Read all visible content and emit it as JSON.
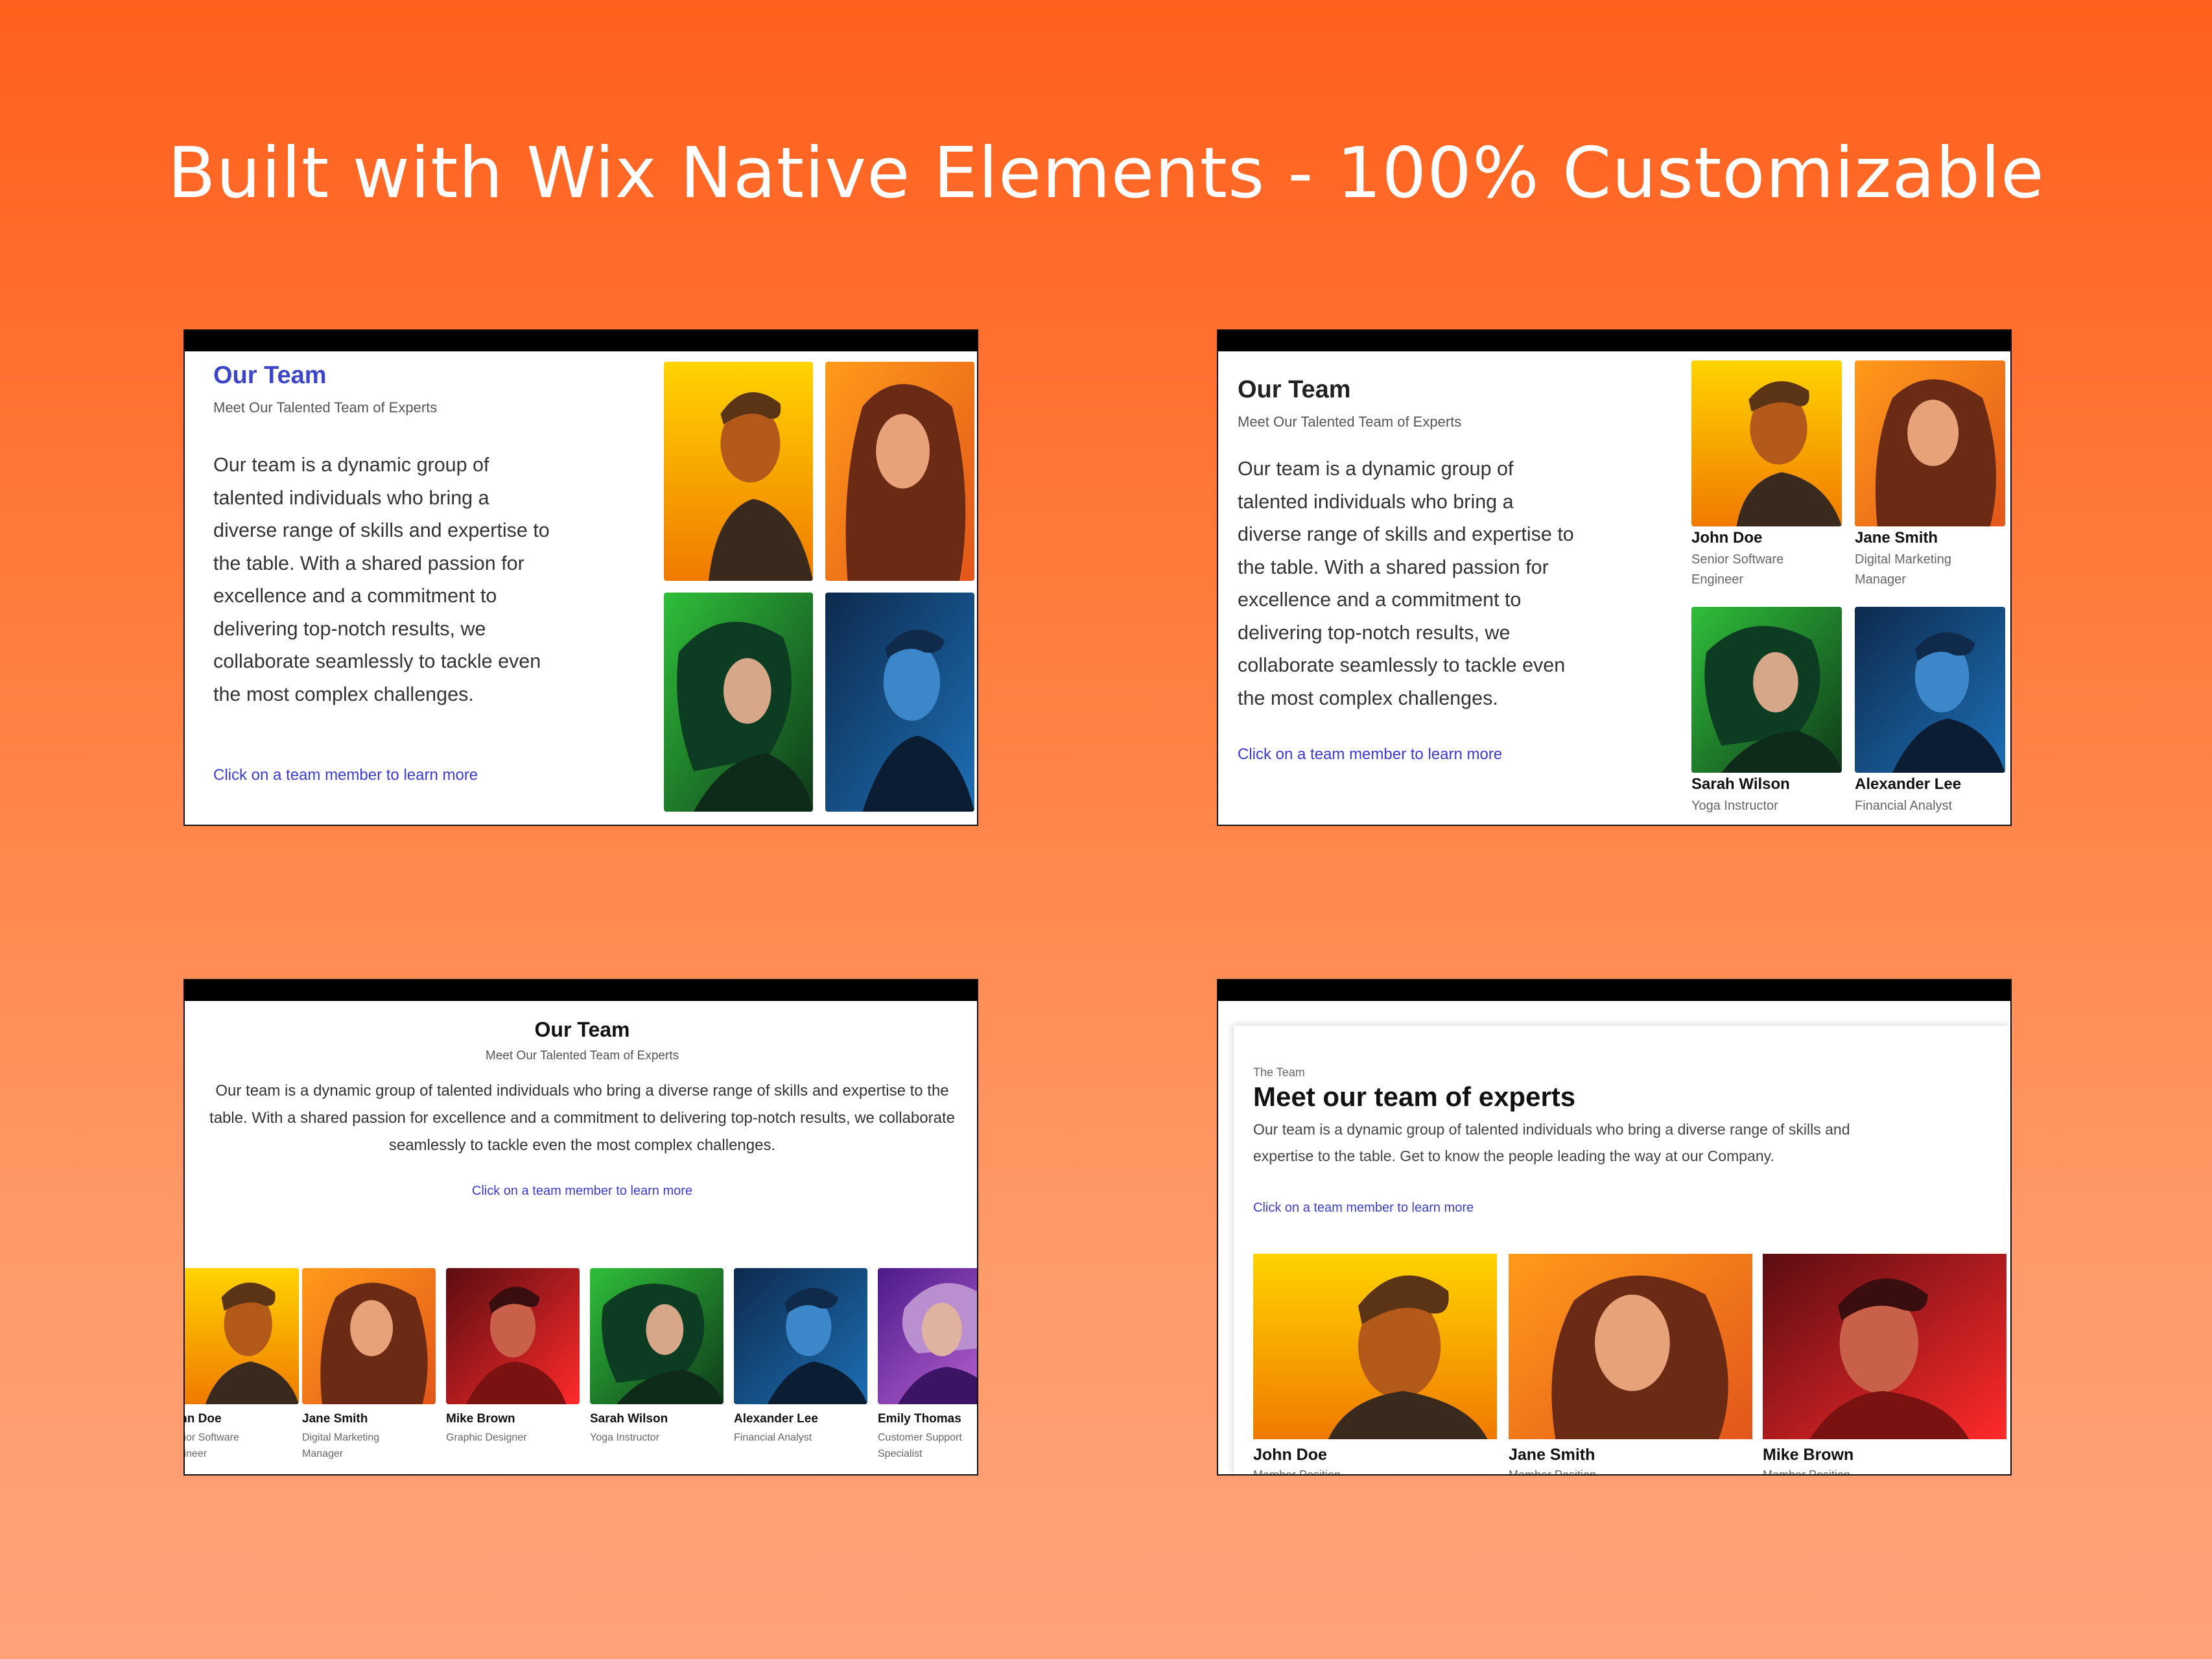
{
  "headline": "Built with Wix Native Elements - 100% Customizable",
  "colors": {
    "accent": "#3b3bd1",
    "accent_title": "#3d45c9",
    "bg_top": "#ff5f1c",
    "bg_bottom": "#ffa27a"
  },
  "team_common": {
    "title": "Our Team",
    "subtitle": "Meet Our Talented Team of Experts",
    "paragraph": "Our team is a dynamic group of talented individuals who bring a diverse range of skills and expertise to the table. With a shared passion for excellence and a commitment to delivering top-notch results, we collaborate seamlessly to tackle even the most complex challenges.",
    "link": "Click on a team member to learn more"
  },
  "paragraph_lines": [
    "Our team is a dynamic group of",
    "talented individuals who bring a",
    "diverse range of skills and expertise to",
    "the table. With a shared passion for",
    "excellence and a commitment to",
    "delivering top-notch results, we",
    "collaborate seamlessly to tackle even",
    "the most complex challenges."
  ],
  "card3": {
    "lines": [
      "Our team is a dynamic group of talented individuals who bring a diverse range of skills and expertise to the",
      "table. With a shared passion for excellence and a commitment to delivering top-notch results, we collaborate",
      "seamlessly to tackle even the most complex challenges."
    ],
    "members": [
      {
        "name": "John Doe",
        "role1": "Senior Software",
        "role2": "Engineer"
      },
      {
        "name": "Jane Smith",
        "role1": "Digital Marketing",
        "role2": "Manager"
      },
      {
        "name": "Mike Brown",
        "role1": "Graphic Designer",
        "role2": ""
      },
      {
        "name": "Sarah Wilson",
        "role1": "Yoga Instructor",
        "role2": ""
      },
      {
        "name": "Alexander Lee",
        "role1": "Financial Analyst",
        "role2": ""
      },
      {
        "name": "Emily Thomas",
        "role1": "Customer Support",
        "role2": "Specialist"
      }
    ]
  },
  "card2": {
    "members": [
      {
        "name": "John Doe",
        "role1": "Senior Software",
        "role2": "Engineer"
      },
      {
        "name": "Jane Smith",
        "role1": "Digital Marketing",
        "role2": "Manager"
      },
      {
        "name": "Sarah Wilson",
        "role1": "Yoga Instructor",
        "role2": ""
      },
      {
        "name": "Alexander Lee",
        "role1": "Financial Analyst",
        "role2": ""
      }
    ]
  },
  "card4": {
    "eyebrow": "The Team",
    "title": "Meet our team of experts",
    "line1": "Our team is a dynamic group of talented individuals who bring a diverse range of skills and",
    "line2": "expertise to the table. Get to know the people leading the way at our Company.",
    "link": "Click on a team member to learn more",
    "members": [
      {
        "name": "John Doe",
        "role": "Member Position"
      },
      {
        "name": "Jane Smith",
        "role": "Member Position"
      },
      {
        "name": "Mike Brown",
        "role": "Member Position"
      }
    ]
  }
}
